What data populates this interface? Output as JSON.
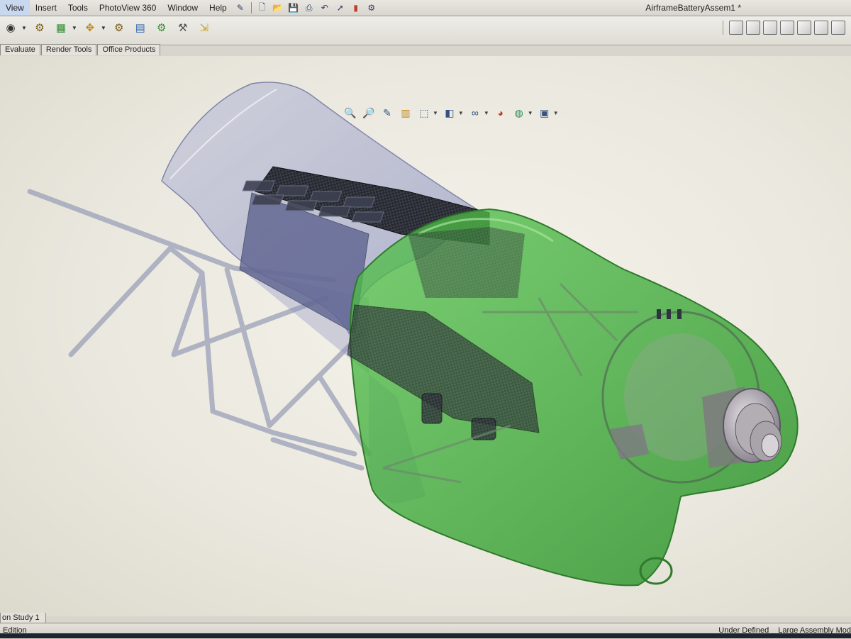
{
  "menu": {
    "items": [
      "View",
      "Insert",
      "Tools",
      "PhotoView 360",
      "Window",
      "Help"
    ]
  },
  "window_title": "AirframeBatteryAssem1 *",
  "tabs": [
    "Evaluate",
    "Render Tools",
    "Office Products"
  ],
  "bottom_tab": "on Study 1",
  "status": {
    "left": "Edition",
    "state": "Under Defined",
    "mode": "Large Assembly Mod"
  },
  "colors": {
    "fairing_green": "#3faa3a",
    "fairing_blue": "#8f95c4",
    "carbon": "#23252c",
    "frame": "#9aa0b8"
  },
  "icons": {
    "quick_access": [
      "pin-icon",
      "new-document-icon",
      "open-folder-icon",
      "save-icon",
      "print-icon",
      "undo-icon",
      "select-icon",
      "rebuild-icon",
      "options-icon"
    ],
    "heads_up_view": [
      "zoom-to-fit-icon",
      "zoom-to-area-icon",
      "previous-view-icon",
      "section-view-icon",
      "view-orientation-icon",
      "display-style-icon",
      "hide-show-items-icon",
      "edit-appearance-icon",
      "apply-scene-icon",
      "view-settings-icon"
    ],
    "view_cubes": [
      "isometric-cube-icon",
      "front-cube-icon",
      "top-cube-icon",
      "right-cube-icon",
      "back-cube-icon",
      "trimetric-cube-icon",
      "dimetric-cube-icon"
    ]
  }
}
